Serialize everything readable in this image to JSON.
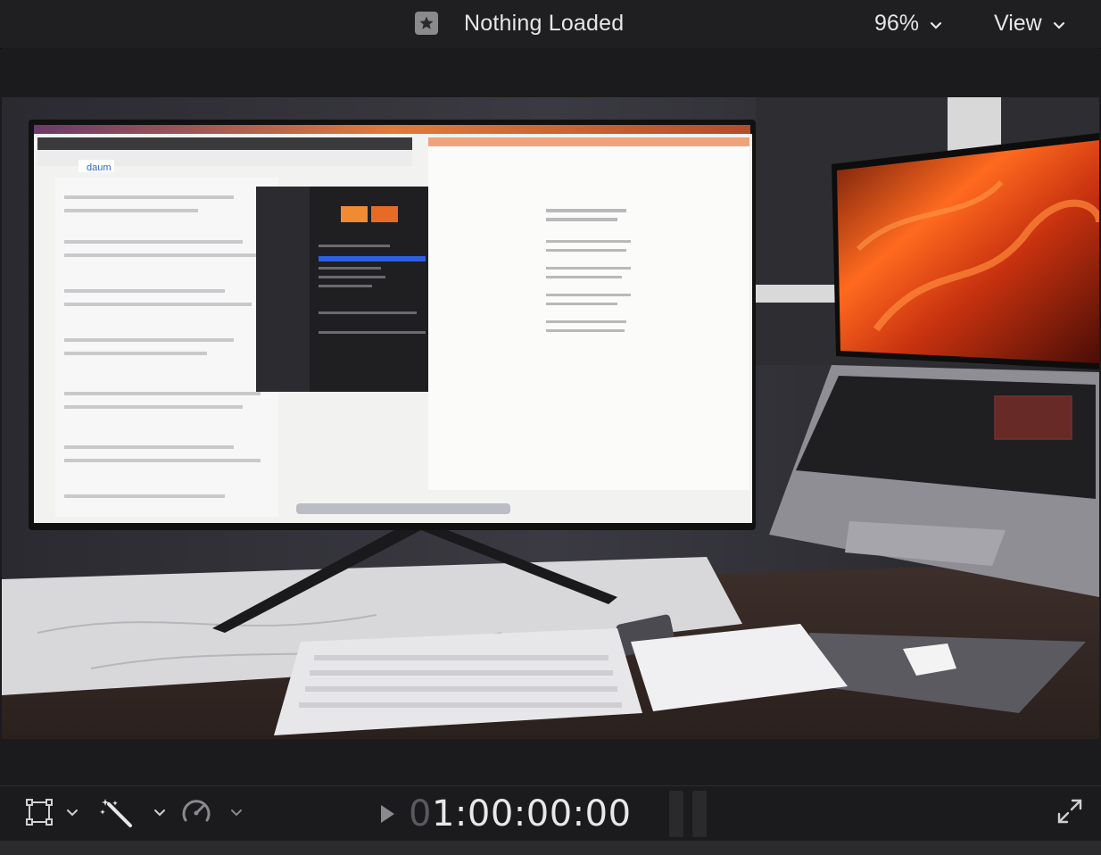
{
  "header": {
    "title": "Nothing Loaded",
    "zoom_label": "96%",
    "view_label": "View",
    "icons": [
      "star-icon",
      "chevron-down-icon"
    ]
  },
  "viewer": {
    "frame_description_icon": "video-frame"
  },
  "toolbar": {
    "transform_icon": "transform-icon",
    "enhance_icon": "magic-wand-icon",
    "speed_icon": "speed-gauge-icon",
    "expand_icon": "fullscreen-icon"
  },
  "playback": {
    "timecode_dim": "0",
    "timecode": "1:00:00:00"
  },
  "colors": {
    "background": "#1b1b1d",
    "accent_text": "#e6e6e6",
    "selection_red": "#c0392b"
  }
}
